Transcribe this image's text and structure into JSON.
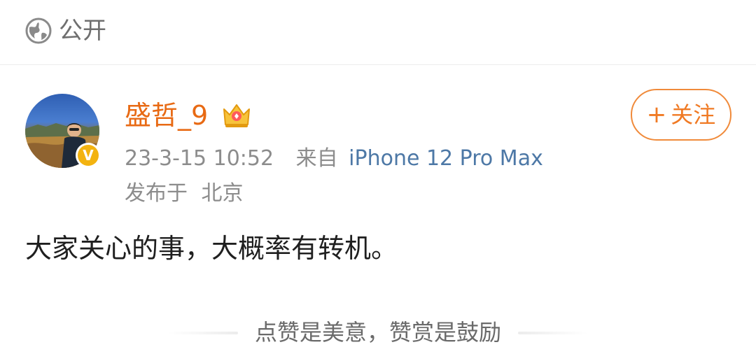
{
  "header": {
    "visibility_icon": "globe-icon",
    "visibility_label": "公开"
  },
  "post": {
    "author": {
      "name": "盛哲_9",
      "verified_icon": "verified-v-icon",
      "verified_mark": "V",
      "member_icon": "crown-icon"
    },
    "follow_button": {
      "plus": "+",
      "label": "关注"
    },
    "timestamp": "23-3-15 10:52",
    "source_prefix": "来自",
    "source_device": "iPhone 12 Pro Max",
    "location_prefix": "发布于",
    "location": "北京",
    "text": "大家关心的事，大概率有转机。"
  },
  "footer": {
    "text": "点赞是美意，赞赏是鼓励"
  },
  "colors": {
    "username": "#e86a14",
    "accent": "#f07a24",
    "device_link": "#4d78a6",
    "meta_gray": "#8c8c8c",
    "verified_badge": "#f3b310"
  }
}
